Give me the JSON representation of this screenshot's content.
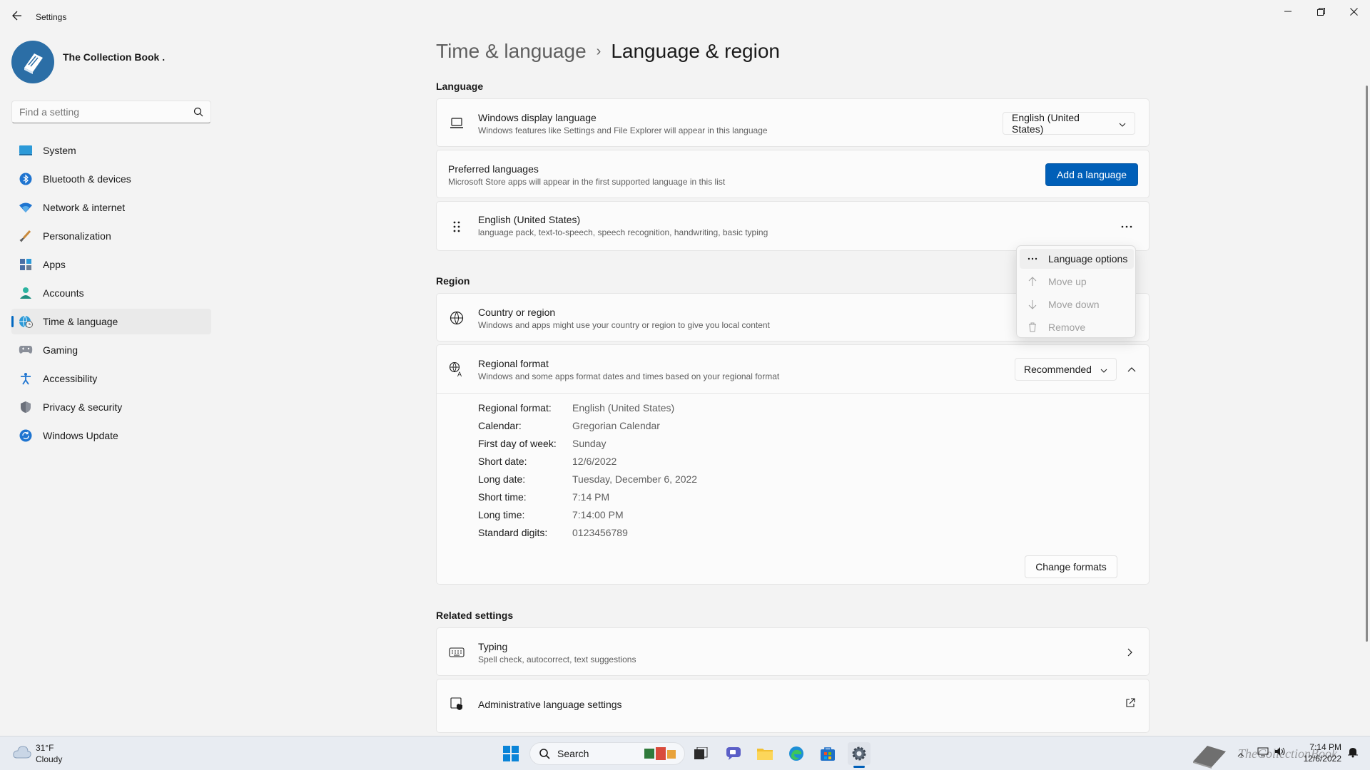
{
  "window": {
    "title": "Settings"
  },
  "profile": {
    "name": "The Collection Book ."
  },
  "search": {
    "placeholder": "Find a setting"
  },
  "sidebar": {
    "items": [
      {
        "label": "System",
        "icon": "system-icon"
      },
      {
        "label": "Bluetooth & devices",
        "icon": "bluetooth-icon"
      },
      {
        "label": "Network & internet",
        "icon": "wifi-icon"
      },
      {
        "label": "Personalization",
        "icon": "brush-icon"
      },
      {
        "label": "Apps",
        "icon": "apps-icon"
      },
      {
        "label": "Accounts",
        "icon": "person-icon"
      },
      {
        "label": "Time & language",
        "icon": "globe-clock-icon",
        "active": true
      },
      {
        "label": "Gaming",
        "icon": "gamepad-icon"
      },
      {
        "label": "Accessibility",
        "icon": "accessibility-icon"
      },
      {
        "label": "Privacy & security",
        "icon": "shield-icon"
      },
      {
        "label": "Windows Update",
        "icon": "update-icon"
      }
    ]
  },
  "breadcrumb": {
    "parent": "Time & language",
    "separator": "›",
    "current": "Language & region"
  },
  "language": {
    "section_title": "Language",
    "display_language": {
      "title": "Windows display language",
      "subtitle": "Windows features like Settings and File Explorer will appear in this language",
      "value": "English (United States)"
    },
    "preferred": {
      "title": "Preferred languages",
      "subtitle": "Microsoft Store apps will appear in the first supported language in this list",
      "button": "Add a language"
    },
    "entry": {
      "title": "English (United States)",
      "subtitle": "language pack, text-to-speech, speech recognition, handwriting, basic typing",
      "more": "..."
    }
  },
  "context_menu": {
    "items": [
      {
        "label": "Language options",
        "icon": "more-icon",
        "enabled": true
      },
      {
        "label": "Move up",
        "icon": "arrow-up-icon",
        "enabled": false
      },
      {
        "label": "Move down",
        "icon": "arrow-down-icon",
        "enabled": false
      },
      {
        "label": "Remove",
        "icon": "trash-icon",
        "enabled": false
      }
    ]
  },
  "region": {
    "section_title": "Region",
    "country": {
      "title": "Country or region",
      "subtitle": "Windows and apps might use your country or region to give you local content"
    },
    "format": {
      "title": "Regional format",
      "subtitle": "Windows and some apps format dates and times based on your regional format",
      "value": "Recommended",
      "details": [
        {
          "label": "Regional format:",
          "value": "English (United States)"
        },
        {
          "label": "Calendar:",
          "value": "Gregorian Calendar"
        },
        {
          "label": "First day of week:",
          "value": "Sunday"
        },
        {
          "label": "Short date:",
          "value": "12/6/2022"
        },
        {
          "label": "Long date:",
          "value": "Tuesday, December 6, 2022"
        },
        {
          "label": "Short time:",
          "value": "7:14 PM"
        },
        {
          "label": "Long time:",
          "value": "7:14:00 PM"
        },
        {
          "label": "Standard digits:",
          "value": "0123456789"
        }
      ],
      "change_button": "Change formats"
    }
  },
  "related": {
    "section_title": "Related settings",
    "typing": {
      "title": "Typing",
      "subtitle": "Spell check, autocorrect, text suggestions"
    },
    "admin": {
      "title": "Administrative language settings"
    }
  },
  "taskbar": {
    "weather_temp": "31°F",
    "weather_condition": "Cloudy",
    "search_label": "Search",
    "time": "7:14 PM",
    "date": "12/6/2022",
    "watermark": "TheCollectionBook"
  },
  "colors": {
    "accent": "#005fb8",
    "background": "#f3f3f3",
    "card": "#fbfbfb"
  }
}
